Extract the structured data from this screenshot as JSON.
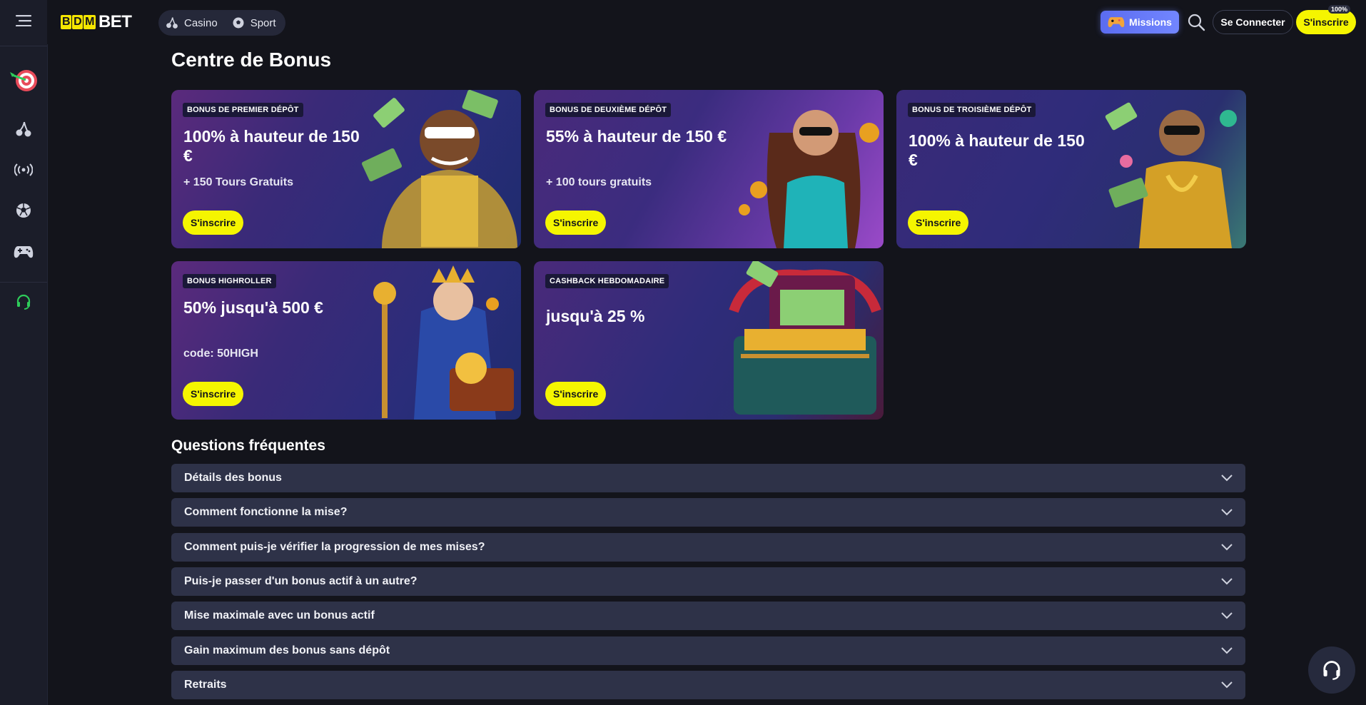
{
  "logo": {
    "letters": [
      "B",
      "D",
      "M"
    ],
    "bet": "BET"
  },
  "nav": {
    "casino": "Casino",
    "sport": "Sport"
  },
  "header": {
    "missions": "Missions",
    "connect": "Se Connecter",
    "signup": "S'inscrire",
    "badge": "100%"
  },
  "page_title": "Centre de Bonus",
  "cards": [
    {
      "tag": "BONUS DE PREMIER DÉPÔT",
      "title": "100% à hauteur de 150 €",
      "sub": "+ 150 Tours Gratuits",
      "cta": "S'inscrire"
    },
    {
      "tag": "BONUS DE DEUXIÈME DÉPÔT",
      "title": "55% à hauteur de 150 €",
      "sub": "+ 100 tours gratuits",
      "cta": "S'inscrire"
    },
    {
      "tag": "BONUS DE TROISIÈME DÉPÔT",
      "title": "100% à hauteur de 150 €",
      "sub": "",
      "cta": "S'inscrire"
    },
    {
      "tag": "BONUS HIGHROLLER",
      "title": "50% jusqu'à 500 €",
      "sub": "code: 50HIGH",
      "cta": "S'inscrire"
    },
    {
      "tag": "CASHBACK HEBDOMADAIRE",
      "title": "jusqu'à 25 %",
      "sub": "",
      "cta": "S'inscrire"
    }
  ],
  "faq_title": "Questions fréquentes",
  "faq": [
    "Détails des bonus",
    "Comment fonctionne la mise?",
    "Comment puis-je vérifier la progression de mes mises?",
    "Puis-je passer d'un bonus actif à un autre?",
    "Mise maximale avec un bonus actif",
    "Gain maximum des bonus sans dépôt",
    "Retraits"
  ],
  "colors": {
    "accent_yellow": "#f5f500",
    "bg": "#13141b",
    "faq_bg": "#2e3248",
    "support_green": "#2ecc5a"
  }
}
